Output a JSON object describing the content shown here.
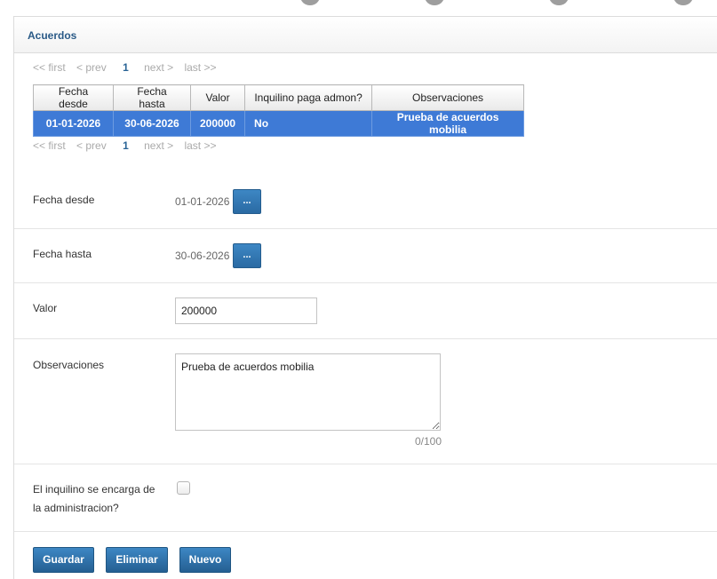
{
  "panel": {
    "title": "Acuerdos"
  },
  "pager": {
    "first": "<< first",
    "prev": "< prev",
    "current": "1",
    "next": "next >",
    "last": "last >>"
  },
  "table": {
    "headers": [
      "Fecha desde",
      "Fecha hasta",
      "Valor",
      "Inquilino paga admon?",
      "Observaciones"
    ],
    "rows": [
      [
        "01-01-2026",
        "30-06-2026",
        "200000",
        "No",
        "Prueba de acuerdos mobilia"
      ]
    ]
  },
  "form": {
    "fecha_desde": {
      "label": "Fecha desde",
      "value": "01-01-2026",
      "button": "..."
    },
    "fecha_hasta": {
      "label": "Fecha hasta",
      "value": "30-06-2026",
      "button": "..."
    },
    "valor": {
      "label": "Valor",
      "value": "200000"
    },
    "observaciones": {
      "label": "Observaciones",
      "value": "Prueba de acuerdos mobilia",
      "counter": "0/100"
    },
    "admin": {
      "label_line1": "El inquilino se encarga de",
      "label_line2": "la administracion?",
      "checked": false
    }
  },
  "actions": {
    "save": "Guardar",
    "delete": "Eliminar",
    "new": "Nuevo"
  }
}
